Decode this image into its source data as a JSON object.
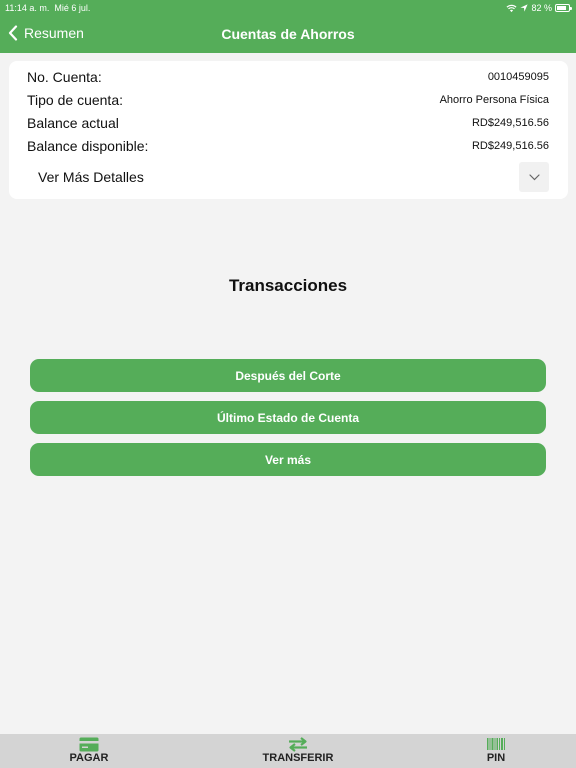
{
  "status": {
    "time": "11:14 a. m.",
    "date": "Mié 6 jul.",
    "battery": "82 %"
  },
  "header": {
    "back_label": "Resumen",
    "title": "Cuentas de Ahorros"
  },
  "account": {
    "rows": [
      {
        "label": "No. Cuenta:",
        "value": "0010459095"
      },
      {
        "label": "Tipo de cuenta:",
        "value": "Ahorro Persona Física"
      },
      {
        "label": "Balance actual",
        "value": "RD$249,516.56"
      },
      {
        "label": "Balance disponible:",
        "value": "RD$249,516.56"
      }
    ],
    "more_details": "Ver Más Detalles"
  },
  "transactions": {
    "title": "Transacciones",
    "buttons": [
      "Después del Corte",
      "Último Estado de Cuenta",
      "Ver más"
    ]
  },
  "tabbar": {
    "items": [
      {
        "label": "PAGAR",
        "icon": "card-icon"
      },
      {
        "label": "TRANSFERIR",
        "icon": "transfer-arrows-icon"
      },
      {
        "label": "PIN",
        "icon": "barcode-icon"
      }
    ]
  },
  "colors": {
    "brand": "#55ad59",
    "background": "#f3f3f3",
    "tabbar": "#d4d4d4"
  }
}
